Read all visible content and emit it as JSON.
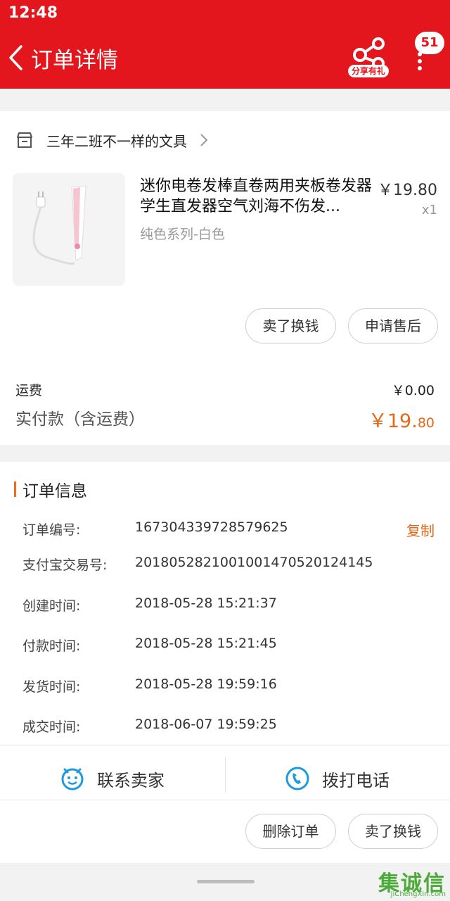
{
  "status_bar": {
    "time": "12:48"
  },
  "header": {
    "title": "订单详情",
    "share_label": "分享有礼",
    "badge_count": "51"
  },
  "shop": {
    "name": "三年二班不一样的文具"
  },
  "product": {
    "title": "迷你电卷发棒直卷两用夹板卷发器学生直发器空气刘海不伤发...",
    "price": "￥19.80",
    "quantity": "x1",
    "variant": "纯色系列-白色"
  },
  "item_actions": {
    "sell_label": "卖了换钱",
    "after_sale_label": "申请售后"
  },
  "summary": {
    "shipping_label": "运费",
    "shipping_value": "￥0.00",
    "paid_label": "实付款（含运费）",
    "paid_main": "￥19.",
    "paid_cents": "80"
  },
  "order_info": {
    "title": "订单信息",
    "copy_label": "复制",
    "rows": [
      {
        "label": "订单编号:",
        "value": "167304339728579625"
      },
      {
        "label": "支付宝交易号:",
        "value": "2018052821001001470520124145"
      },
      {
        "label": "创建时间:",
        "value": "2018-05-28 15:21:37"
      },
      {
        "label": "付款时间:",
        "value": "2018-05-28 15:21:45"
      },
      {
        "label": "发货时间:",
        "value": "2018-05-28 19:59:16"
      },
      {
        "label": "成交时间:",
        "value": "2018-06-07 19:59:25"
      }
    ]
  },
  "contact": {
    "seller_label": "联系卖家",
    "phone_label": "拨打电话"
  },
  "bottom_actions": {
    "delete_label": "删除订单",
    "sell_label": "卖了换钱"
  },
  "watermark": {
    "cn": "集诚信",
    "en": "JiChengXin.com"
  },
  "colors": {
    "brand_red": "#e3161d",
    "accent_orange": "#e5681a",
    "contact_blue": "#1e9bdc"
  }
}
